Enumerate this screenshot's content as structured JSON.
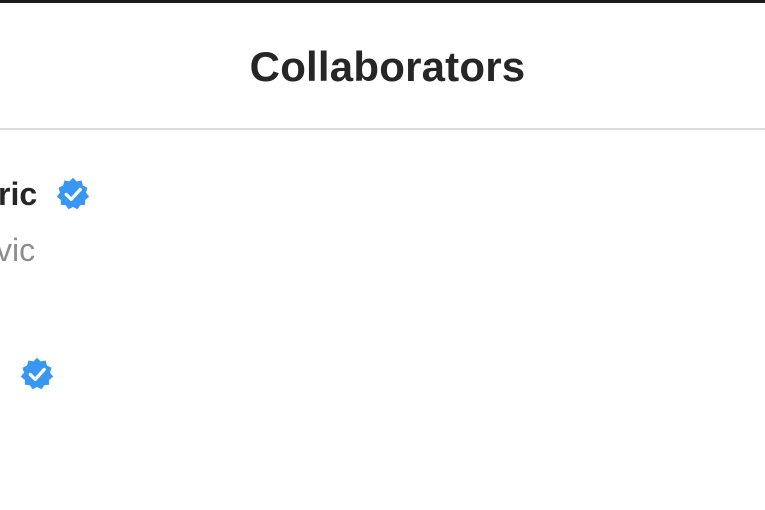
{
  "header": {
    "title": "Collaborators"
  },
  "collaborators": [
    {
      "name": "ric",
      "handle": "vic",
      "verified": true
    },
    {
      "name": "",
      "handle": "",
      "verified": true
    }
  ],
  "colors": {
    "verified_badge": "#3897f0",
    "title_text": "#262626",
    "secondary_text": "#8e8e8e",
    "divider": "#dbdbdb"
  },
  "icons": {
    "verified": "verified-badge-icon"
  }
}
